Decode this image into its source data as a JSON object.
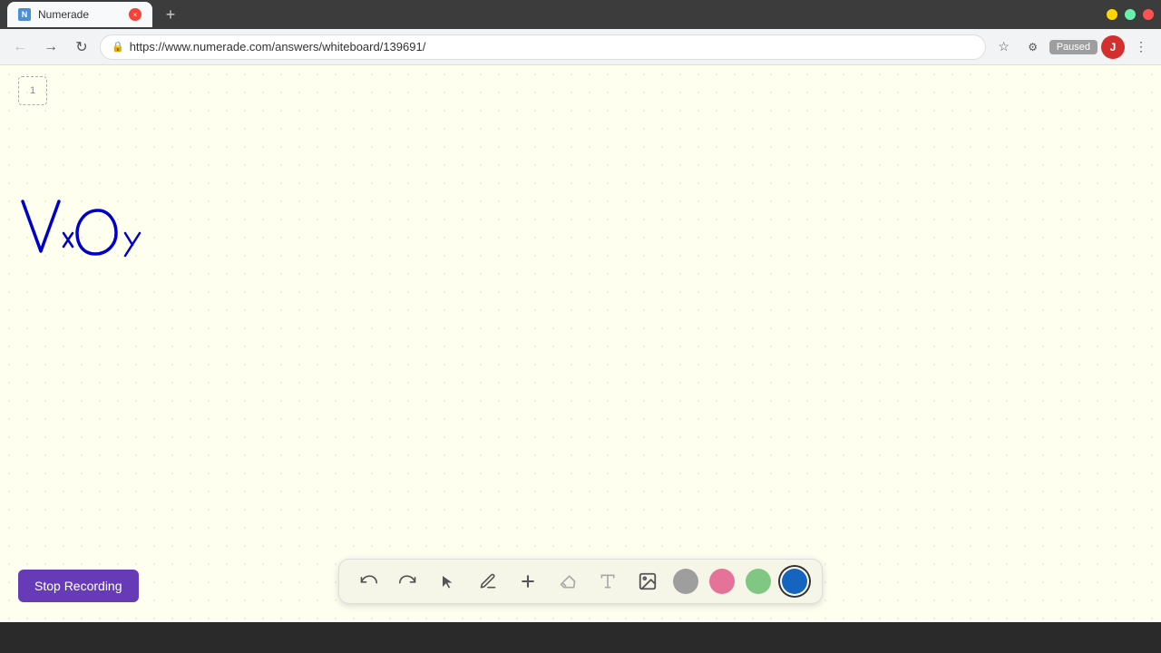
{
  "browser": {
    "tab": {
      "title": "Numerade",
      "favicon_label": "N",
      "recording_dot_color": "#f44336",
      "new_tab_label": "+"
    },
    "address": {
      "url": "https://www.numerade.com/answers/whiteboard/139691/"
    },
    "status": {
      "paused_label": "Paused"
    },
    "nav": {
      "back_icon": "←",
      "forward_icon": "→",
      "refresh_icon": "↻"
    }
  },
  "whiteboard": {
    "page_number": "1",
    "math_content": "Vx Oy"
  },
  "toolbar": {
    "undo_label": "undo",
    "redo_label": "redo",
    "select_label": "select",
    "pen_label": "pen",
    "add_label": "add",
    "eraser_label": "eraser",
    "text_label": "text",
    "image_label": "image",
    "colors": [
      {
        "name": "gray",
        "value": "#9e9e9e"
      },
      {
        "name": "pink",
        "value": "#e91e8c"
      },
      {
        "name": "light-green",
        "value": "#81c784"
      },
      {
        "name": "blue",
        "value": "#1565c0"
      }
    ]
  },
  "recording": {
    "stop_button_label": "Stop Recording"
  }
}
